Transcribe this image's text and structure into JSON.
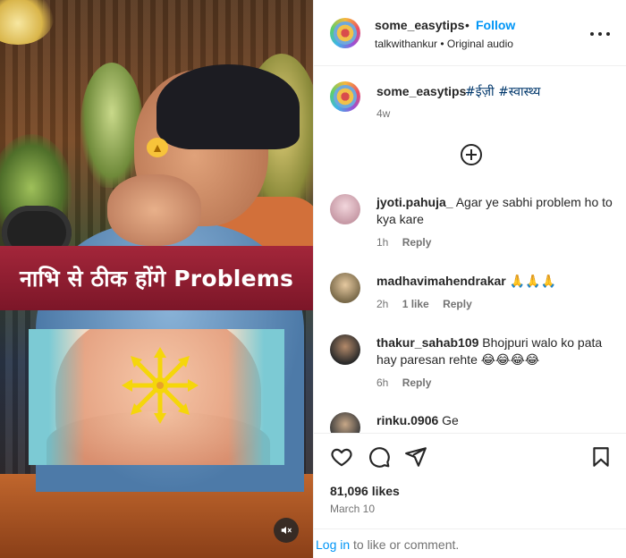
{
  "post": {
    "username": "some_easytips",
    "separator": "•",
    "follow_label": "Follow",
    "audio_line": "talkwithankur • Original audio",
    "more_icon": "more-options-icon"
  },
  "media": {
    "banner_text": "नाभि से ठीक होंगे Problems",
    "mute_icon": "speaker-muted-icon"
  },
  "caption": {
    "username": "some_easytips",
    "hashtags": "#ईज़ी #स्वास्थ्य",
    "age": "4w",
    "load_more_icon": "plus-circle-icon"
  },
  "comments": [
    {
      "username": "jyoti.pahuja_",
      "text": "Agar ye sabhi problem ho to kya kare",
      "age": "1h",
      "likes": "",
      "reply": "Reply"
    },
    {
      "username": "madhavimahendrakar",
      "text": "🙏🙏🙏",
      "age": "2h",
      "likes": "1 like",
      "reply": "Reply"
    },
    {
      "username": "thakur_sahab109",
      "text": "Bhojpuri walo ko pata hay paresan rehte 😂😂😂😂",
      "age": "6h",
      "likes": "",
      "reply": "Reply"
    },
    {
      "username": "rinku.0906",
      "text": "Ge",
      "age": "",
      "likes": "",
      "reply": ""
    }
  ],
  "actions": {
    "like_icon": "heart-icon",
    "comment_icon": "comment-icon",
    "share_icon": "paper-plane-icon",
    "save_icon": "bookmark-icon",
    "likes_count": "81,096 likes",
    "date": "March 10",
    "login_link": "Log in",
    "login_rest": "to like or comment."
  },
  "colors": {
    "link_blue": "#0095f6",
    "hashtag_blue": "#00376b",
    "banner_red": "#a3263a",
    "muted_gray": "#737373"
  }
}
